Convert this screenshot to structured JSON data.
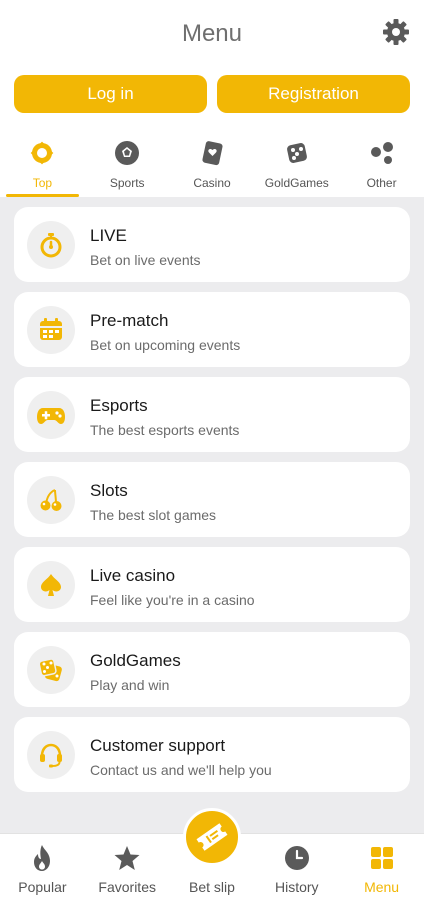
{
  "header": {
    "title": "Menu",
    "settings_icon": "gear-icon"
  },
  "auth": {
    "login_label": "Log in",
    "register_label": "Registration"
  },
  "tabs": [
    {
      "label": "Top",
      "icon": "badge-icon",
      "active": true
    },
    {
      "label": "Sports",
      "icon": "soccer-ball-icon",
      "active": false
    },
    {
      "label": "Casino",
      "icon": "playing-card-icon",
      "active": false
    },
    {
      "label": "GoldGames",
      "icon": "dice-icon",
      "active": false
    },
    {
      "label": "Other",
      "icon": "dots-cluster-icon",
      "active": false
    }
  ],
  "menu_items": [
    {
      "title": "LIVE",
      "subtitle": "Bet on live events",
      "icon": "stopwatch-icon"
    },
    {
      "title": "Pre-match",
      "subtitle": "Bet on upcoming events",
      "icon": "calendar-icon"
    },
    {
      "title": "Esports",
      "subtitle": "The best esports events",
      "icon": "gamepad-icon"
    },
    {
      "title": "Slots",
      "subtitle": "The best slot games",
      "icon": "cherries-icon"
    },
    {
      "title": "Live casino",
      "subtitle": "Feel like you're in a casino",
      "icon": "spade-icon"
    },
    {
      "title": "GoldGames",
      "subtitle": "Play and win",
      "icon": "dice-icon"
    },
    {
      "title": "Customer support",
      "subtitle": "Contact us and we'll help you",
      "icon": "headset-icon"
    }
  ],
  "bottom_nav": [
    {
      "label": "Popular",
      "icon": "flame-icon",
      "active": false
    },
    {
      "label": "Favorites",
      "icon": "star-icon",
      "active": false
    },
    {
      "label": "Bet slip",
      "icon": "ticket-icon",
      "active": false
    },
    {
      "label": "History",
      "icon": "clock-icon",
      "active": false
    },
    {
      "label": "Menu",
      "icon": "grid-icon",
      "active": true
    }
  ],
  "colors": {
    "accent": "#f2b705",
    "background": "#ececee",
    "card": "#ffffff",
    "icon_grey": "#5a5a5a"
  }
}
